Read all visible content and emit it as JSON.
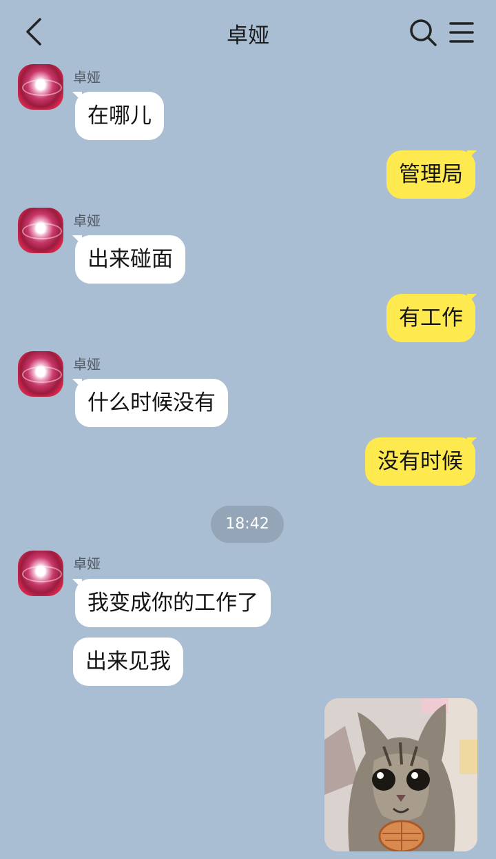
{
  "header": {
    "title": "卓娅"
  },
  "contact": {
    "name": "卓娅"
  },
  "messages": [
    {
      "side": "in",
      "text": "在哪儿"
    },
    {
      "side": "out",
      "text": "管理局"
    },
    {
      "side": "in",
      "text": "出来碰面"
    },
    {
      "side": "out",
      "text": "有工作"
    },
    {
      "side": "in",
      "text": "什么时候没有"
    },
    {
      "side": "out",
      "text": "没有时候"
    },
    {
      "side": "in",
      "text": "我变成你的工作了"
    },
    {
      "side": "in",
      "text": "出来见我"
    }
  ],
  "timestamp": "18:42",
  "icons": {
    "back": "chevron-left-icon",
    "search": "search-icon",
    "menu": "menu-icon"
  },
  "colors": {
    "background": "#a9bed2",
    "incoming": "#ffffff",
    "outgoing": "#fee94e",
    "timestamp": "#93a5b6"
  }
}
